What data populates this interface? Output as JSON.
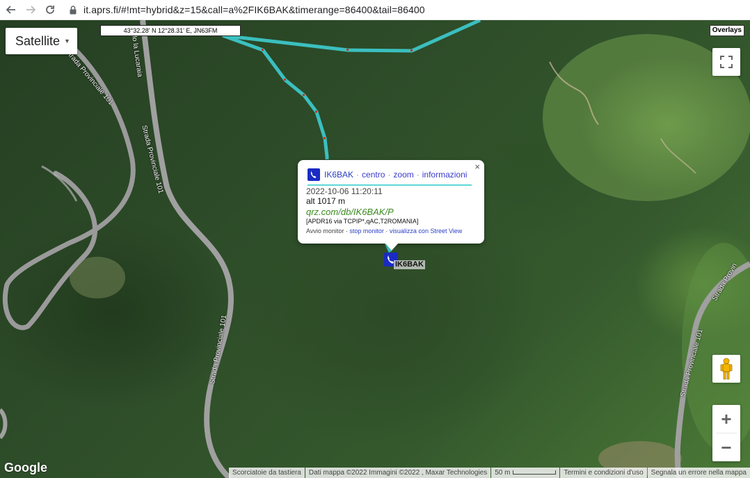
{
  "browser": {
    "back_icon": "back-arrow-icon",
    "forward_icon": "forward-arrow-icon",
    "reload_icon": "reload-icon",
    "url": "it.aprs.fi/#!mt=hybrid&z=15&call=a%2FIK6BAK&timerange=86400&tail=86400"
  },
  "map": {
    "type_selector": "Satellite",
    "coords": "43°32.28' N 12°28.31' E, JN63FM",
    "overlays": "Overlays",
    "zoom_in": "+",
    "zoom_out": "−",
    "google_logo": "Google",
    "road_labels": [
      "Strada Provinciale 101",
      "Strada Provinciale 101",
      "Strada Provinciale 101",
      "Strada Provinciale 101",
      "lo la Lucaraia",
      "Strada Provin"
    ],
    "attribution": {
      "shortcuts": "Scorciatoie da tastiera",
      "data": "Dati mappa ©2022 Immagini ©2022 , Maxar Technologies",
      "scale": "50 m",
      "terms": "Termini e condizioni d'uso",
      "report": "Segnala un errore nella mappa"
    },
    "track_color": "#3bbfbf"
  },
  "popup": {
    "call": "IK6BAK",
    "links": [
      "centro",
      "zoom",
      "informazioni"
    ],
    "time": "2022-10-06 11:20:11",
    "alt": "alt 1017 m",
    "qrz": "qrz.com/db/IK6BAK/P",
    "path": "[APDR16 via TCPIP*,qAC,T2ROMANIA]",
    "monitor_label": "Avvio monitor",
    "stop_monitor": "stop monitor",
    "street_view": "visualizza con Street View",
    "close": "×"
  },
  "station": {
    "label": "IK6BAK",
    "icon": "car-phone-icon"
  }
}
